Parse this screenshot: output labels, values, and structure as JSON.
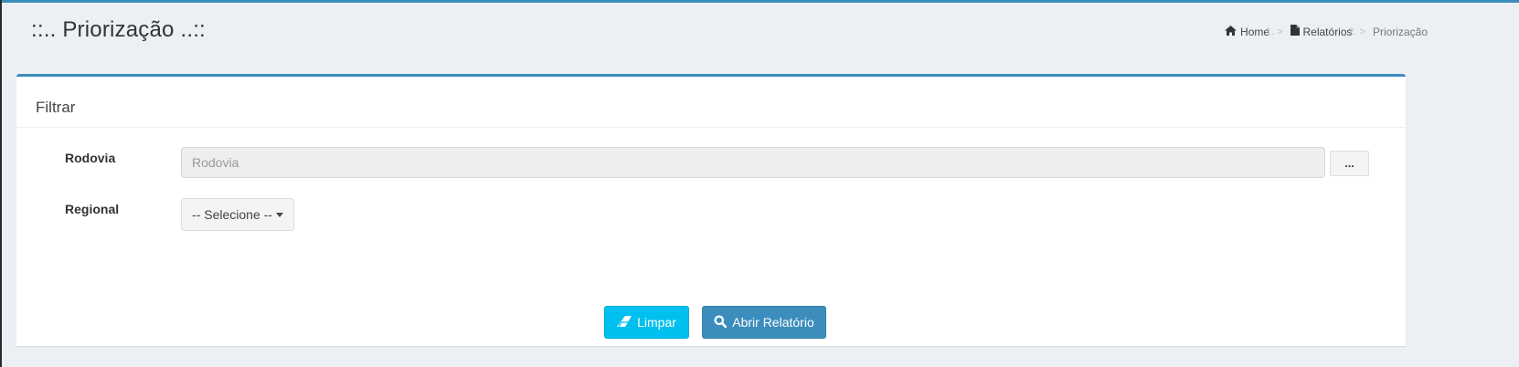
{
  "header": {
    "title": "::.. Priorização ..::"
  },
  "breadcrumb": {
    "items": [
      {
        "label": "Home",
        "icon": "home-icon"
      },
      {
        "label": "Relatórios",
        "icon": "file-icon"
      },
      {
        "label": "Priorização"
      }
    ],
    "separator": ">"
  },
  "filter": {
    "title": "Filtrar",
    "rodovia": {
      "label": "Rodovia",
      "placeholder": "Rodovia",
      "value": "",
      "browse_label": "..."
    },
    "regional": {
      "label": "Regional",
      "selected": "-- Selecione --"
    }
  },
  "actions": {
    "clear_label": "Limpar",
    "clear_icon": "eraser-icon",
    "open_label": "Abrir Relatório",
    "open_icon": "search-icon"
  },
  "colors": {
    "accent": "#3c8dbc",
    "info": "#00c0ef",
    "background": "#ecf0f5"
  }
}
